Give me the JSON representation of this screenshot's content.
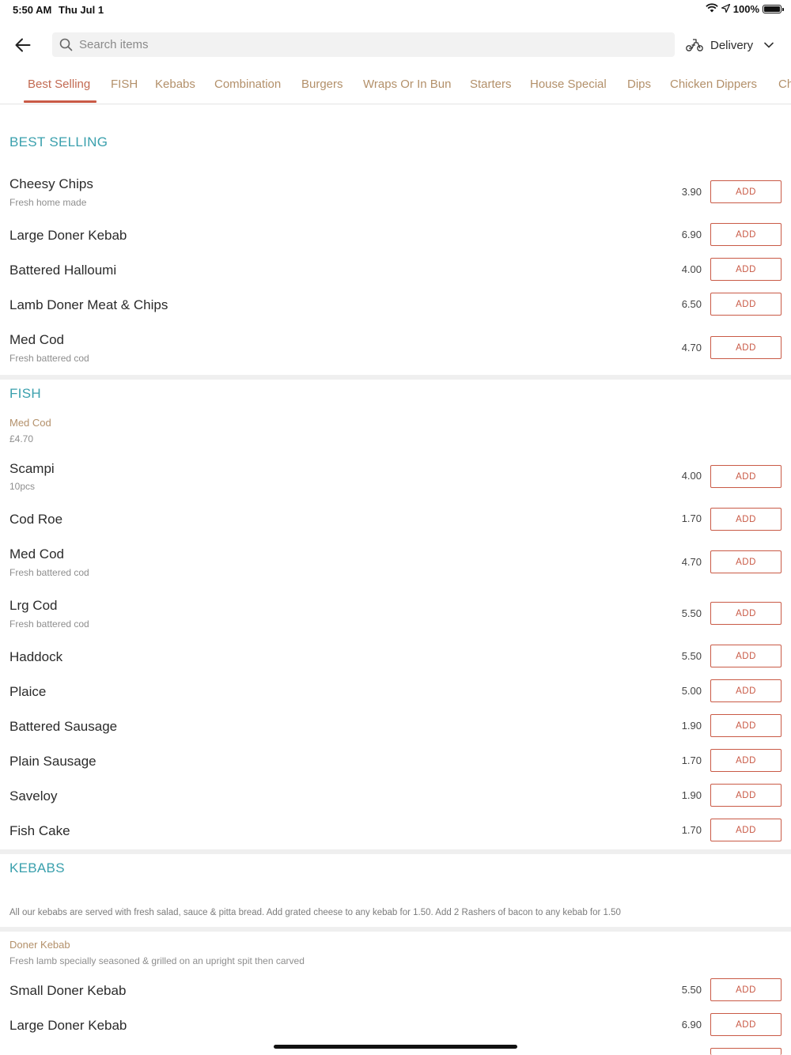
{
  "status": {
    "time": "5:50 AM",
    "date": "Thu Jul 1",
    "battery": "100%"
  },
  "search": {
    "placeholder": "Search items",
    "value": ""
  },
  "delivery": {
    "label": "Delivery"
  },
  "tabs": [
    {
      "label": "Best Selling",
      "active": true
    },
    {
      "label": "FISH"
    },
    {
      "label": "Kebabs"
    },
    {
      "label": "Combination"
    },
    {
      "label": "Burgers"
    },
    {
      "label": "Wraps Or In Bun"
    },
    {
      "label": "Starters"
    },
    {
      "label": "House Special"
    },
    {
      "label": "Dips"
    },
    {
      "label": "Chicken Dippers"
    },
    {
      "label": "Ch"
    }
  ],
  "add_label": "ADD",
  "best_selling": {
    "title": "BEST SELLING",
    "items": [
      {
        "name": "Cheesy Chips",
        "desc": "Fresh home made",
        "price": "3.90"
      },
      {
        "name": "Large Doner Kebab",
        "price": "6.90"
      },
      {
        "name": "Battered Halloumi",
        "price": "4.00"
      },
      {
        "name": "Lamb Doner Meat & Chips",
        "price": "6.50"
      },
      {
        "name": "Med Cod",
        "desc": "Fresh battered cod",
        "price": "4.70"
      }
    ]
  },
  "fish": {
    "title": "FISH",
    "featured": {
      "name": "Med Cod",
      "price": "£4.70"
    },
    "items": [
      {
        "name": "Scampi",
        "desc": "10pcs",
        "price": "4.00"
      },
      {
        "name": "Cod Roe",
        "price": "1.70"
      },
      {
        "name": "Med Cod",
        "desc": "Fresh battered cod",
        "price": "4.70"
      },
      {
        "name": "Lrg Cod",
        "desc": "Fresh battered cod",
        "price": "5.50"
      },
      {
        "name": "Haddock",
        "price": "5.50"
      },
      {
        "name": "Plaice",
        "price": "5.00"
      },
      {
        "name": "Battered Sausage",
        "price": "1.90"
      },
      {
        "name": "Plain Sausage",
        "price": "1.70"
      },
      {
        "name": "Saveloy",
        "price": "1.90"
      },
      {
        "name": "Fish Cake",
        "price": "1.70"
      }
    ]
  },
  "kebabs": {
    "title": "KEBABS",
    "note": "All our kebabs are served with fresh salad, sauce & pitta bread. Add grated cheese to any kebab for 1.50. Add 2 Rashers of bacon to any kebab for 1.50",
    "sub_title": "Doner Kebab",
    "sub_desc": "Fresh lamb specially seasoned & grilled on an upright spit then carved",
    "items": [
      {
        "name": "Small Doner Kebab",
        "price": "5.50"
      },
      {
        "name": "Large Doner Kebab",
        "price": "6.90"
      }
    ]
  }
}
